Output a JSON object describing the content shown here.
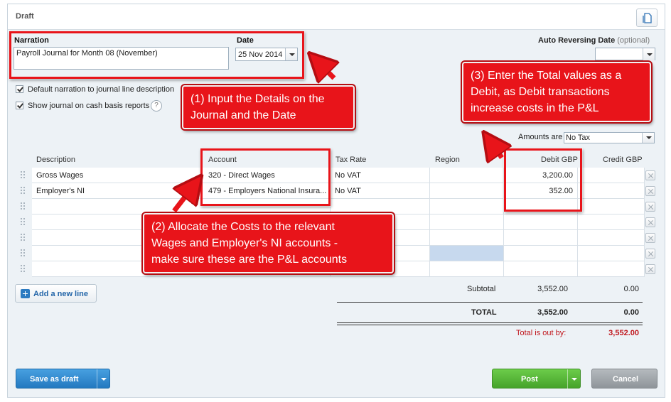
{
  "panel": {
    "title": "Draft"
  },
  "form": {
    "narration_label": "Narration",
    "narration_value": "Payroll Journal for Month 08 (November)",
    "date_label": "Date",
    "date_value": "25 Nov 2014",
    "auto_reversing_label": "Auto Reversing Date",
    "auto_reversing_optional": "(optional)",
    "checkbox_default_narration": "Default narration to journal line description",
    "checkbox_cash_basis": "Show journal on cash basis reports",
    "help_glyph": "?",
    "amounts_label": "Amounts are",
    "amounts_value": "No Tax"
  },
  "grid": {
    "headers": {
      "description": "Description",
      "account": "Account",
      "tax_rate": "Tax Rate",
      "region": "Region",
      "debit": "Debit GBP",
      "credit": "Credit GBP"
    },
    "rows": [
      {
        "description": "Gross Wages",
        "account": "320 - Direct Wages",
        "tax_rate": "No VAT",
        "region": "",
        "debit": "3,200.00",
        "credit": ""
      },
      {
        "description": "Employer's NI",
        "account": "479 - Employers National Insura...",
        "tax_rate": "No VAT",
        "region": "",
        "debit": "352.00",
        "credit": ""
      }
    ],
    "empty_rows": 5
  },
  "add_line": {
    "label": "Add a new line"
  },
  "totals": {
    "subtotal_label": "Subtotal",
    "subtotal_debit": "3,552.00",
    "subtotal_credit": "0.00",
    "total_label": "TOTAL",
    "total_debit": "3,552.00",
    "total_credit": "0.00",
    "out_by_label": "Total is out by:",
    "out_by_value": "3,552.00"
  },
  "buttons": {
    "save_draft": "Save as draft",
    "post": "Post",
    "cancel": "Cancel"
  },
  "callouts": {
    "c1": [
      "(1) Input the Details on the",
      "Journal and the Date"
    ],
    "c2": [
      "(2) Allocate the Costs to the relevant",
      "Wages and Employer's NI accounts -",
      "make sure these are the P&L accounts"
    ],
    "c3": [
      "(3) Enter the Total values as a",
      "Debit, as Debit transactions",
      "increase costs in the P&L"
    ]
  },
  "colors": {
    "accent_red": "#e8141a",
    "save_blue": "#2f8ad1",
    "post_green": "#5bb53c",
    "cancel_grey": "#9da3a8",
    "out_by_red": "#c0161c"
  }
}
